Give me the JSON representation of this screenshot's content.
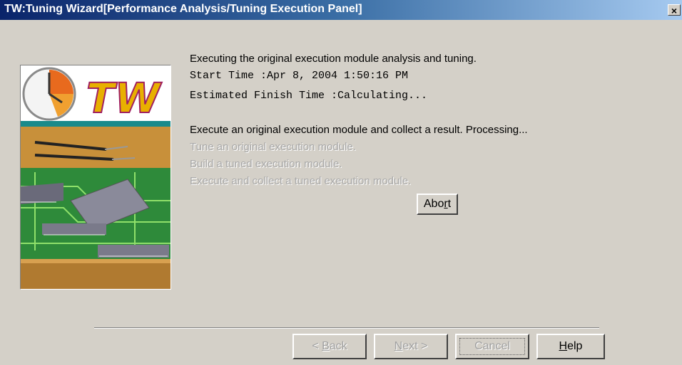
{
  "window": {
    "title": "TW:Tuning Wizard[Performance Analysis/Tuning Execution Panel]",
    "close_label": "×"
  },
  "panel": {
    "heading": "Executing the original execution module analysis and tuning.",
    "start_time": "Start Time :Apr 8, 2004 1:50:16 PM",
    "finish_time": "Estimated Finish Time :Calculating...",
    "steps": [
      {
        "label": "Execute an original execution module and collect a result. Processing...",
        "state": "active"
      },
      {
        "label": "Tune an original execution module.",
        "state": "pending"
      },
      {
        "label": "Build a tuned execution module.",
        "state": "pending"
      },
      {
        "label": "Execute and collect a tuned execution module.",
        "state": "pending"
      }
    ],
    "abort_pre": "Abo",
    "abort_key": "r",
    "abort_post": "t"
  },
  "logo": {
    "text": "TW"
  },
  "footer": {
    "back_pre": "< ",
    "back_key": "B",
    "back_post": "ack",
    "next_pre": "",
    "next_key": "N",
    "next_post": "ext >",
    "cancel_label": "Cancel",
    "help_key": "H",
    "help_post": "elp"
  },
  "colors": {
    "title_gradient_start": "#0a246a",
    "title_gradient_end": "#a6caf0",
    "dialog_bg": "#d4d0c8",
    "disabled_text": "#a8a8a8"
  }
}
